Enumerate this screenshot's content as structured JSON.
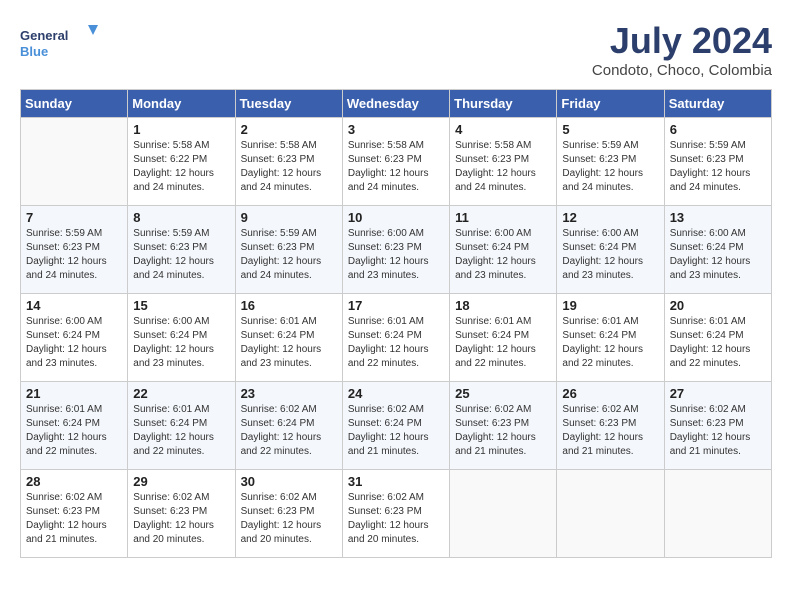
{
  "header": {
    "logo_line1": "General",
    "logo_line2": "Blue",
    "month_title": "July 2024",
    "subtitle": "Condoto, Choco, Colombia"
  },
  "weekdays": [
    "Sunday",
    "Monday",
    "Tuesday",
    "Wednesday",
    "Thursday",
    "Friday",
    "Saturday"
  ],
  "weeks": [
    [
      {
        "day": "",
        "info": ""
      },
      {
        "day": "1",
        "info": "Sunrise: 5:58 AM\nSunset: 6:22 PM\nDaylight: 12 hours\nand 24 minutes."
      },
      {
        "day": "2",
        "info": "Sunrise: 5:58 AM\nSunset: 6:23 PM\nDaylight: 12 hours\nand 24 minutes."
      },
      {
        "day": "3",
        "info": "Sunrise: 5:58 AM\nSunset: 6:23 PM\nDaylight: 12 hours\nand 24 minutes."
      },
      {
        "day": "4",
        "info": "Sunrise: 5:58 AM\nSunset: 6:23 PM\nDaylight: 12 hours\nand 24 minutes."
      },
      {
        "day": "5",
        "info": "Sunrise: 5:59 AM\nSunset: 6:23 PM\nDaylight: 12 hours\nand 24 minutes."
      },
      {
        "day": "6",
        "info": "Sunrise: 5:59 AM\nSunset: 6:23 PM\nDaylight: 12 hours\nand 24 minutes."
      }
    ],
    [
      {
        "day": "7",
        "info": "Sunrise: 5:59 AM\nSunset: 6:23 PM\nDaylight: 12 hours\nand 24 minutes."
      },
      {
        "day": "8",
        "info": "Sunrise: 5:59 AM\nSunset: 6:23 PM\nDaylight: 12 hours\nand 24 minutes."
      },
      {
        "day": "9",
        "info": "Sunrise: 5:59 AM\nSunset: 6:23 PM\nDaylight: 12 hours\nand 24 minutes."
      },
      {
        "day": "10",
        "info": "Sunrise: 6:00 AM\nSunset: 6:23 PM\nDaylight: 12 hours\nand 23 minutes."
      },
      {
        "day": "11",
        "info": "Sunrise: 6:00 AM\nSunset: 6:24 PM\nDaylight: 12 hours\nand 23 minutes."
      },
      {
        "day": "12",
        "info": "Sunrise: 6:00 AM\nSunset: 6:24 PM\nDaylight: 12 hours\nand 23 minutes."
      },
      {
        "day": "13",
        "info": "Sunrise: 6:00 AM\nSunset: 6:24 PM\nDaylight: 12 hours\nand 23 minutes."
      }
    ],
    [
      {
        "day": "14",
        "info": "Sunrise: 6:00 AM\nSunset: 6:24 PM\nDaylight: 12 hours\nand 23 minutes."
      },
      {
        "day": "15",
        "info": "Sunrise: 6:00 AM\nSunset: 6:24 PM\nDaylight: 12 hours\nand 23 minutes."
      },
      {
        "day": "16",
        "info": "Sunrise: 6:01 AM\nSunset: 6:24 PM\nDaylight: 12 hours\nand 23 minutes."
      },
      {
        "day": "17",
        "info": "Sunrise: 6:01 AM\nSunset: 6:24 PM\nDaylight: 12 hours\nand 22 minutes."
      },
      {
        "day": "18",
        "info": "Sunrise: 6:01 AM\nSunset: 6:24 PM\nDaylight: 12 hours\nand 22 minutes."
      },
      {
        "day": "19",
        "info": "Sunrise: 6:01 AM\nSunset: 6:24 PM\nDaylight: 12 hours\nand 22 minutes."
      },
      {
        "day": "20",
        "info": "Sunrise: 6:01 AM\nSunset: 6:24 PM\nDaylight: 12 hours\nand 22 minutes."
      }
    ],
    [
      {
        "day": "21",
        "info": "Sunrise: 6:01 AM\nSunset: 6:24 PM\nDaylight: 12 hours\nand 22 minutes."
      },
      {
        "day": "22",
        "info": "Sunrise: 6:01 AM\nSunset: 6:24 PM\nDaylight: 12 hours\nand 22 minutes."
      },
      {
        "day": "23",
        "info": "Sunrise: 6:02 AM\nSunset: 6:24 PM\nDaylight: 12 hours\nand 22 minutes."
      },
      {
        "day": "24",
        "info": "Sunrise: 6:02 AM\nSunset: 6:24 PM\nDaylight: 12 hours\nand 21 minutes."
      },
      {
        "day": "25",
        "info": "Sunrise: 6:02 AM\nSunset: 6:23 PM\nDaylight: 12 hours\nand 21 minutes."
      },
      {
        "day": "26",
        "info": "Sunrise: 6:02 AM\nSunset: 6:23 PM\nDaylight: 12 hours\nand 21 minutes."
      },
      {
        "day": "27",
        "info": "Sunrise: 6:02 AM\nSunset: 6:23 PM\nDaylight: 12 hours\nand 21 minutes."
      }
    ],
    [
      {
        "day": "28",
        "info": "Sunrise: 6:02 AM\nSunset: 6:23 PM\nDaylight: 12 hours\nand 21 minutes."
      },
      {
        "day": "29",
        "info": "Sunrise: 6:02 AM\nSunset: 6:23 PM\nDaylight: 12 hours\nand 20 minutes."
      },
      {
        "day": "30",
        "info": "Sunrise: 6:02 AM\nSunset: 6:23 PM\nDaylight: 12 hours\nand 20 minutes."
      },
      {
        "day": "31",
        "info": "Sunrise: 6:02 AM\nSunset: 6:23 PM\nDaylight: 12 hours\nand 20 minutes."
      },
      {
        "day": "",
        "info": ""
      },
      {
        "day": "",
        "info": ""
      },
      {
        "day": "",
        "info": ""
      }
    ]
  ]
}
